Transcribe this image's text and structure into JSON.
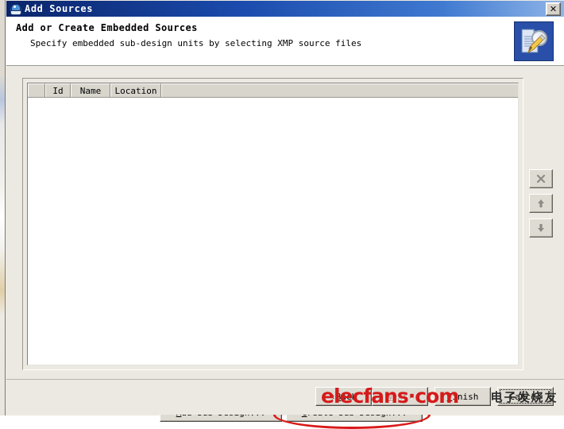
{
  "window": {
    "title": "Add Sources",
    "title_icon": "app-icon",
    "close_label": "✕"
  },
  "header": {
    "title": "Add or Create Embedded Sources",
    "subtitle": "Specify embedded sub-design units by selecting XMP source files",
    "icon": "documents-search-edit-icon"
  },
  "table": {
    "columns": [
      "",
      "Id",
      "Name",
      "Location"
    ],
    "rows": []
  },
  "side_tools": [
    {
      "name": "remove-button",
      "glyph": "✕",
      "enabled": false
    },
    {
      "name": "move-up-button",
      "glyph": "↑",
      "enabled": false
    },
    {
      "name": "move-down-button",
      "glyph": "↓",
      "enabled": false
    }
  ],
  "actions": {
    "add_sub_design": {
      "mnemonic": "A",
      "rest": "dd Sub-Design..."
    },
    "create_sub_design": {
      "mnemonic": "C",
      "rest": "reate Sub-Design..."
    }
  },
  "footer": {
    "back": {
      "prefix": "‹ ",
      "mnemonic": "B",
      "rest": "ack"
    },
    "next": {
      "mnemonic": "N",
      "rest": "ext",
      "suffix": " ›",
      "enabled": false
    },
    "finish": {
      "mnemonic": "F",
      "rest": "inish"
    },
    "cancel": {
      "label": "Cancel"
    }
  },
  "annotations": {
    "highlight_ellipse": "create-sub-design"
  },
  "watermark": {
    "site": "elecfans·com",
    "chinese": "电子发烧友"
  },
  "colors": {
    "titlebar_start": "#0a246a",
    "titlebar_end": "#8fb5e8",
    "dialog_face": "#ece9e2",
    "annotation_red": "#d91a1a",
    "watermark_red": "#d51a1a",
    "header_icon_blue": "#2a4fa8"
  }
}
